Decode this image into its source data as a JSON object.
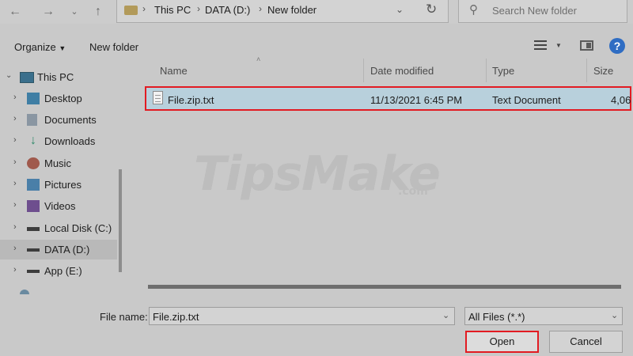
{
  "address": {
    "crumbs": [
      "This PC",
      "DATA (D:)",
      "New folder"
    ],
    "search_placeholder": "Search New folder"
  },
  "toolbar": {
    "organize_label": "Organize",
    "new_folder_label": "New folder",
    "help_label": "?"
  },
  "sidebar": {
    "items": [
      {
        "label": "This PC",
        "icon": "monitor-icon"
      },
      {
        "label": "Desktop",
        "icon": "desktop-icon"
      },
      {
        "label": "Documents",
        "icon": "documents-icon"
      },
      {
        "label": "Downloads",
        "icon": "download-icon"
      },
      {
        "label": "Music",
        "icon": "music-icon"
      },
      {
        "label": "Pictures",
        "icon": "pictures-icon"
      },
      {
        "label": "Videos",
        "icon": "videos-icon"
      },
      {
        "label": "Local Disk (C:)",
        "icon": "drive-icon"
      },
      {
        "label": "DATA (D:)",
        "icon": "drive-icon",
        "selected": true
      },
      {
        "label": "App (E:)",
        "icon": "drive-icon"
      }
    ]
  },
  "columns": [
    "Name",
    "Date modified",
    "Type",
    "Size"
  ],
  "files": [
    {
      "name": "File.zip.txt",
      "date_modified": "11/13/2021 6:45 PM",
      "type": "Text Document",
      "size": "4,06"
    }
  ],
  "bottom": {
    "file_name_label": "File name:",
    "file_name_value": "File.zip.txt",
    "filter_value": "All Files (*.*)",
    "open_label": "Open",
    "cancel_label": "Cancel"
  },
  "watermark": {
    "main": "TipsMake",
    "sub": ".com"
  },
  "colors": {
    "highlight": "#e21b22",
    "selection": "#b8d0dc",
    "help": "#2f6dc3"
  }
}
